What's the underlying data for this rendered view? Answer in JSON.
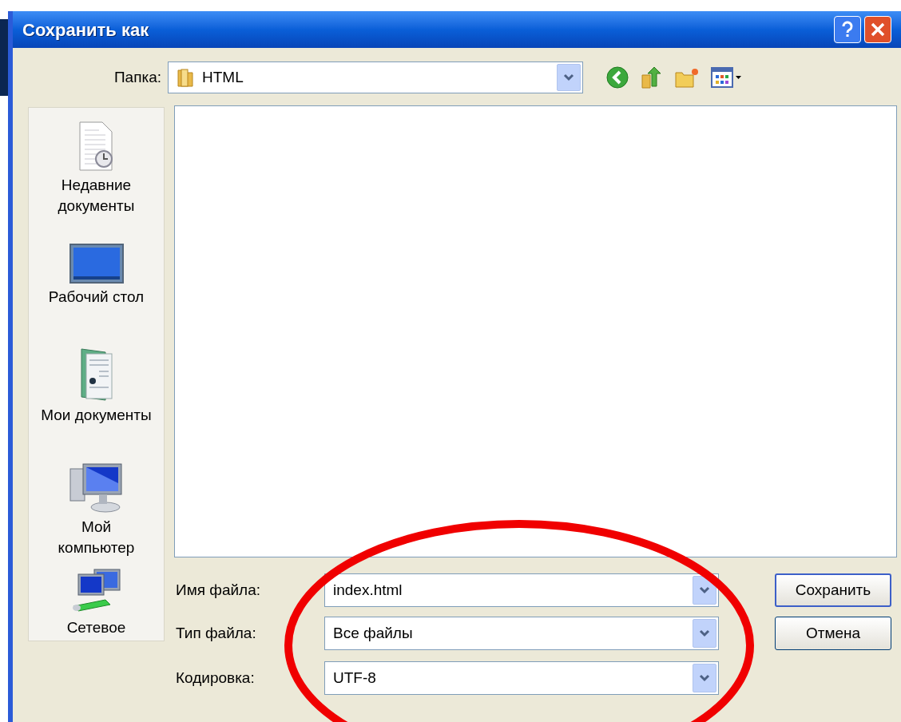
{
  "window": {
    "title": "Сохранить как"
  },
  "folder": {
    "label": "Папка:",
    "value": "HTML"
  },
  "places": [
    {
      "kind": "recent",
      "label": "Недавние\nдокументы"
    },
    {
      "kind": "desktop",
      "label": "Рабочий стол"
    },
    {
      "kind": "documents",
      "label": "Мои документы"
    },
    {
      "kind": "computer",
      "label": "Мой\nкомпьютер"
    },
    {
      "kind": "network",
      "label": "Сетевое"
    }
  ],
  "fields": [
    {
      "label": "Имя файла:",
      "value": "index.html"
    },
    {
      "label": "Тип файла:",
      "value": "Все файлы"
    },
    {
      "label": "Кодировка:",
      "value": "UTF-8"
    }
  ],
  "buttons": [
    {
      "label": "Сохранить",
      "default": true
    },
    {
      "label": "Отмена",
      "default": false
    }
  ]
}
